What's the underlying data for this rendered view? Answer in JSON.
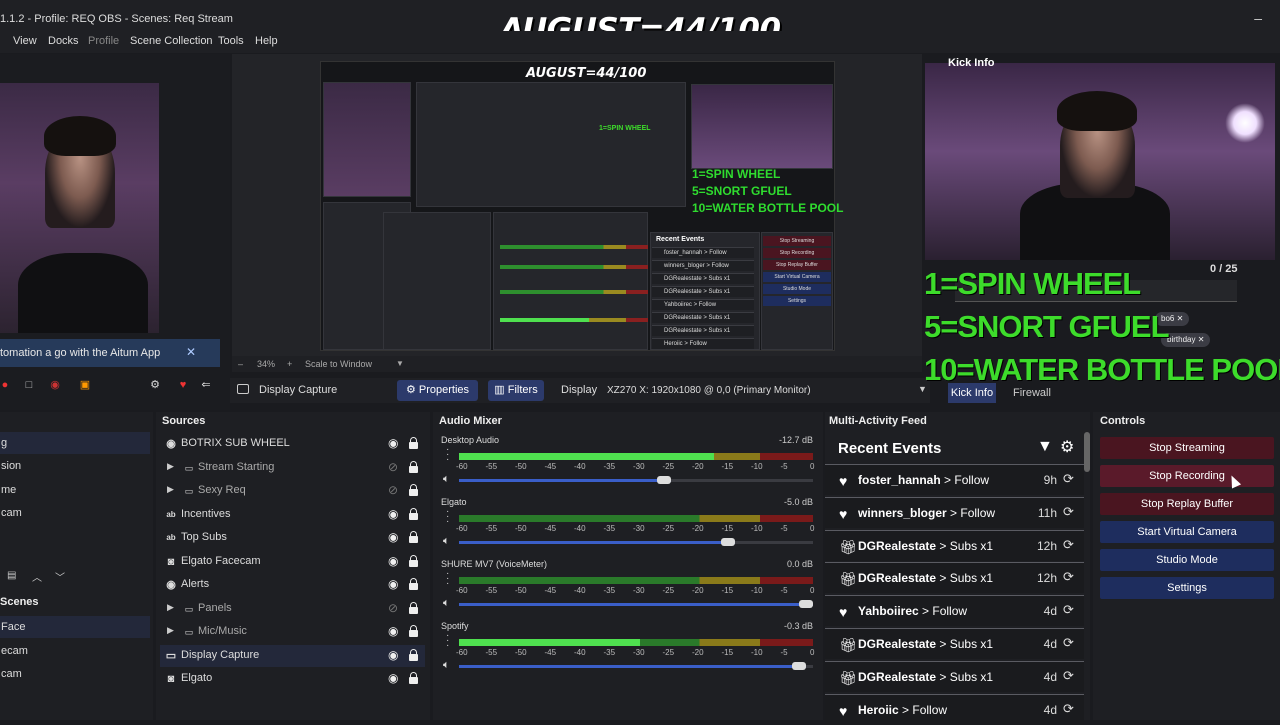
{
  "window": {
    "title": "1.1.2 - Profile: REQ OBS - Scenes: Req Stream",
    "minimize": "–"
  },
  "overlay": {
    "title": "AUGUST=44/100"
  },
  "menu": [
    "View",
    "Docks",
    "Profile",
    "Scene Collection",
    "Tools",
    "Help"
  ],
  "aitum": {
    "text": "tomation a go with the Aitum App",
    "close": "✕"
  },
  "preview": {
    "zoom": "34%",
    "zoom_plus": "+",
    "zoom_minus": "–",
    "scale_label": "Scale to Window",
    "mini_title": "AUGUST=44/100",
    "mini_green_1": "1=SPIN WHEEL",
    "mini_green_2": "5=SNORT GFUEL",
    "mini_green_3": "10=WATER BOTTLE POOL",
    "mini_recent": "Recent Events",
    "mini_events": [
      "foster_hannah > Follow",
      "winners_bloger > Follow",
      "DGRealestate > Subs x1",
      "DGRealestate > Subs x1",
      "Yahboiirec > Follow",
      "DGRealestate > Subs x1",
      "DGRealestate > Subs x1",
      "Heroiic > Follow"
    ],
    "mini_controls": [
      "Stop Streaming",
      "Stop Recording",
      "Stop Replay Buffer",
      "Start Virtual Camera",
      "Studio Mode",
      "Settings"
    ]
  },
  "props": {
    "source_name": "Display Capture",
    "properties": "Properties",
    "filters": "Filters",
    "display_label": "Display",
    "display_value": "XZ270 X: 1920x1080 @ 0,0 (Primary Monitor)"
  },
  "kick": {
    "title": "Kick Info",
    "count": "0 / 25",
    "tags": [
      "bo6",
      "birthday"
    ],
    "tag_close": "✕",
    "green_1": "1=SPIN WHEEL",
    "green_2": "5=SNORT GFUEL",
    "green_3": "10=WATER BOTTLE POOL",
    "tab_kick": "Kick Info",
    "tab_firewall": "Firewall"
  },
  "scenes": {
    "header": "Scenes",
    "top_items": [
      "g",
      "sion",
      "me",
      "cam"
    ],
    "items": [
      "Face",
      "ecam",
      "cam"
    ]
  },
  "sources": {
    "header": "Sources",
    "items": [
      {
        "name": "BOTRIX SUB WHEEL",
        "icon": "globe-icon",
        "folder": false,
        "hidden": false
      },
      {
        "name": "Stream Starting",
        "icon": "folder-icon",
        "folder": true,
        "hidden": true
      },
      {
        "name": "Sexy Req",
        "icon": "folder-icon",
        "folder": true,
        "hidden": true
      },
      {
        "name": "Incentives",
        "icon": "text-icon",
        "folder": false,
        "hidden": false
      },
      {
        "name": "Top Subs",
        "icon": "text-icon",
        "folder": false,
        "hidden": false
      },
      {
        "name": "Elgato Facecam",
        "icon": "camera-icon",
        "folder": false,
        "hidden": false
      },
      {
        "name": "Alerts",
        "icon": "globe-icon",
        "folder": false,
        "hidden": false
      },
      {
        "name": "Panels",
        "icon": "folder-icon",
        "folder": true,
        "hidden": true
      },
      {
        "name": "Mic/Music",
        "icon": "folder-icon",
        "folder": true,
        "hidden": false
      },
      {
        "name": "Display Capture",
        "icon": "monitor-icon",
        "folder": false,
        "hidden": false
      },
      {
        "name": "Elgato",
        "icon": "camera-icon",
        "folder": false,
        "hidden": false
      }
    ]
  },
  "mixer": {
    "header": "Audio Mixer",
    "ticks": [
      "-60",
      "-55",
      "-50",
      "-45",
      "-40",
      "-35",
      "-30",
      "-25",
      "-20",
      "-15",
      "-10",
      "-5",
      "0"
    ],
    "channels": [
      {
        "name": "Desktop Audio",
        "db": "-12.7 dB",
        "level": 0.72,
        "volume": 0.6
      },
      {
        "name": "Elgato",
        "db": "-5.0 dB",
        "level": 0.0,
        "volume": 0.78
      },
      {
        "name": "SHURE MV7 (VoiceMeter)",
        "db": "0.0 dB",
        "level": 0.0,
        "volume": 1.0
      },
      {
        "name": "Spotify",
        "db": "-0.3 dB",
        "level": 0.51,
        "volume": 0.98
      }
    ]
  },
  "feed": {
    "header": "Multi-Activity Feed",
    "title": "Recent Events",
    "events": [
      {
        "user": "foster_hannah",
        "action": "> Follow",
        "time": "9h",
        "icon": "heart-icon"
      },
      {
        "user": "winners_bloger",
        "action": "> Follow",
        "time": "11h",
        "icon": "heart-icon"
      },
      {
        "user": "DGRealestate",
        "action": "> Subs x1",
        "time": "12h",
        "icon": "gift-icon"
      },
      {
        "user": "DGRealestate",
        "action": "> Subs x1",
        "time": "12h",
        "icon": "gift-icon"
      },
      {
        "user": "Yahboiirec",
        "action": "> Follow",
        "time": "4d",
        "icon": "heart-icon"
      },
      {
        "user": "DGRealestate",
        "action": "> Subs x1",
        "time": "4d",
        "icon": "gift-icon"
      },
      {
        "user": "DGRealestate",
        "action": "> Subs x1",
        "time": "4d",
        "icon": "gift-icon"
      },
      {
        "user": "Heroiic",
        "action": "> Follow",
        "time": "4d",
        "icon": "heart-icon"
      }
    ]
  },
  "controls": {
    "header": "Controls",
    "buttons": [
      "Stop Streaming",
      "Stop Recording",
      "Stop Replay Buffer",
      "Start Virtual Camera",
      "Studio Mode",
      "Settings"
    ]
  },
  "colors": {
    "accent_blue": "#2c3a6b",
    "stop_red": "#4a1520",
    "green_text": "#3ddc2b"
  }
}
